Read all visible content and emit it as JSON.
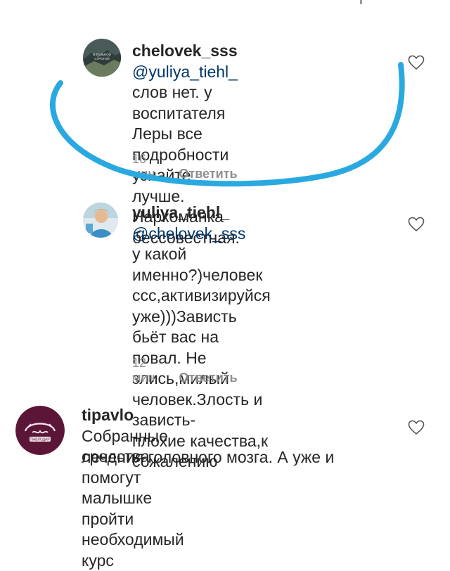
{
  "comments": [
    {
      "username": "chelovek_sss",
      "mention": "@yuliya_tiehl_",
      "lines": [
        "слов нет.  у воспитателя",
        "Леры все подробности",
        "узнайте лучше.  Наркоманка",
        "бессовестная."
      ],
      "time": "16 мин",
      "reply_label": "Ответить",
      "avatar_text": [
        "В ТАЛЬНОЙ",
        "СТРОГОЙ"
      ]
    },
    {
      "username": "yuliya_tiehl_",
      "mention": "@chelovek_sss",
      "lines": [
        "у какой именно?)человек",
        "ссс,активизируйся",
        "уже)))Зависть бьёт вас на",
        "повал. Не злись,милый",
        "человек.Злость и зависть-",
        "плохие качества,к сожалению"
      ],
      "time": "12 мин",
      "reply_label": "Ответить"
    },
    {
      "username": "tipavlo",
      "first_line_text": "Собранные средства помогут",
      "lines": [
        "малышке пройти необходимый курс",
        "лечения головного мозга. А уже и"
      ],
      "avatar_text": [
        "ПАВЛОДАР"
      ]
    }
  ],
  "colors": {
    "text": "#262626",
    "meta": "#8e8e8e",
    "mention": "#00376b",
    "highlight_stroke": "#2aa9e0"
  },
  "icons": [
    "heart-icon",
    "heart-icon",
    "heart-icon"
  ]
}
